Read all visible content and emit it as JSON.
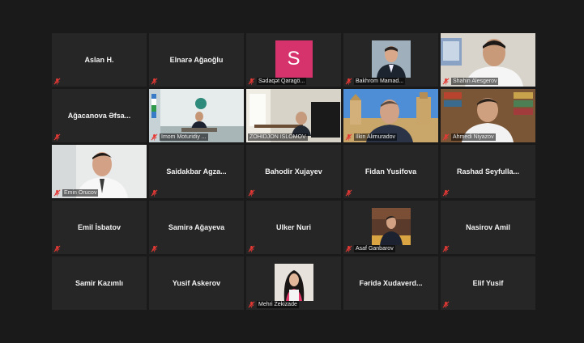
{
  "participants": [
    {
      "name": "Aslan H.",
      "display": "name"
    },
    {
      "name": "Elnarə Ağaoğlu",
      "display": "name"
    },
    {
      "name": "Sədaqət Qaragö...",
      "display": "avatar",
      "avatar_letter": "S",
      "avatar_color": "#d6336c"
    },
    {
      "name": "Bakhrom Mamad...",
      "display": "photo"
    },
    {
      "name": "Shahin Alesgerov",
      "display": "video"
    },
    {
      "name": "Ağacanova Əfsa...",
      "display": "name"
    },
    {
      "name": "Imom Moturidiy ...",
      "display": "video"
    },
    {
      "name": "ZOHIDJON ISLOMOV",
      "display": "video",
      "active_speaker": true
    },
    {
      "name": "Ilkin Alimuradov",
      "display": "video"
    },
    {
      "name": "Ahmedi Niyazov",
      "display": "video"
    },
    {
      "name": "Emin Orucov",
      "display": "video"
    },
    {
      "name": "Saidakbar Agza...",
      "display": "name"
    },
    {
      "name": "Bahodir Xujayev",
      "display": "name"
    },
    {
      "name": "Fidan Yusifova",
      "display": "name"
    },
    {
      "name": "Rashad Seyfulla...",
      "display": "name"
    },
    {
      "name": "Emil İsbatov",
      "display": "name"
    },
    {
      "name": "Samirə Ağayeva",
      "display": "name"
    },
    {
      "name": "Ulker Nuri",
      "display": "name"
    },
    {
      "name": "Asaf Ganbarov",
      "display": "photo"
    },
    {
      "name": "Nasirov Amil",
      "display": "name"
    },
    {
      "name": "Samir Kazımlı",
      "display": "name"
    },
    {
      "name": "Yusif Askerov",
      "display": "name"
    },
    {
      "name": "Mehri Zekizade",
      "display": "photo"
    },
    {
      "name": "Fəridə Xudaverd...",
      "display": "name"
    },
    {
      "name": "Elif Yusif",
      "display": "name"
    }
  ],
  "colors": {
    "background": "#1a1a1a",
    "tile": "#262626",
    "muted_mic": "#e53935",
    "active_speaker_border": "#c8e64a"
  }
}
